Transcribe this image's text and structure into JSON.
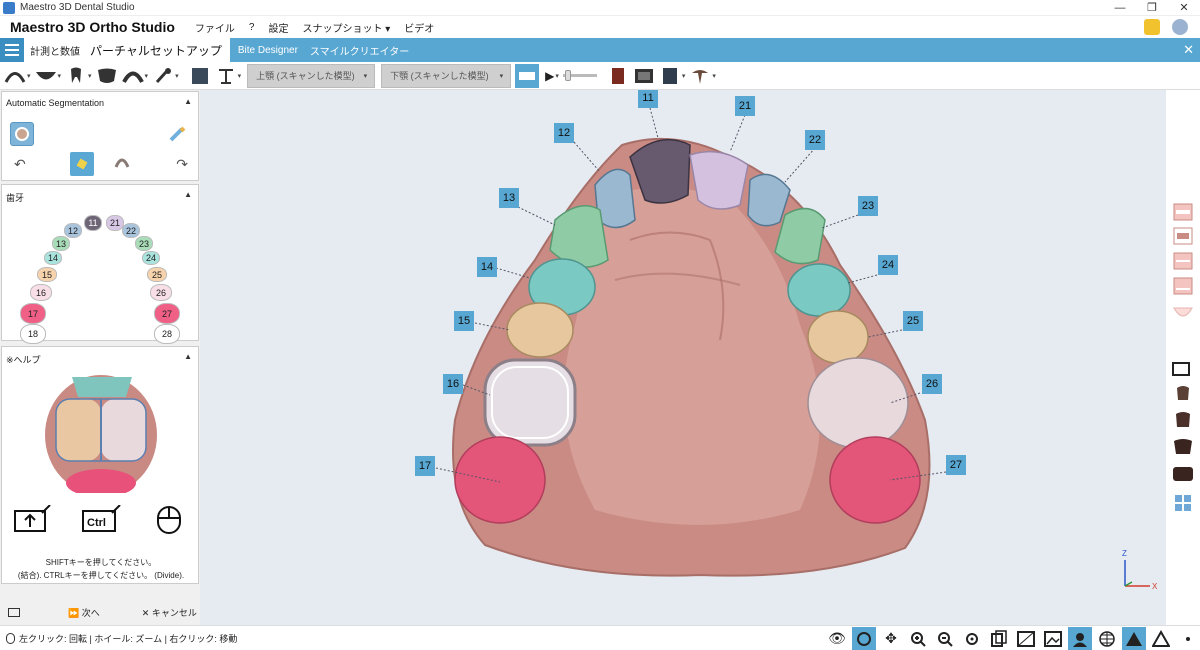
{
  "window": {
    "title": "Maestro 3D Dental Studio",
    "minimize": "—",
    "maximize": "❐",
    "close": "✕"
  },
  "menu": {
    "brand": "Maestro 3D Ortho Studio",
    "items": [
      "ファイル",
      "?",
      "設定",
      "スナップショット",
      "ビデオ"
    ],
    "snapshot_caret": "▾"
  },
  "modebar": {
    "tab_measure": "計測と数値",
    "tab_partial": "パーチャルセットアップ",
    "tab_bite": "Bite Designer",
    "tab_smile": "スマイルクリエイター",
    "close": "✕"
  },
  "toolbar": {
    "upper_select": "上顎 (スキャンした模型)",
    "lower_select": "下顎 (スキャンした模型)",
    "play": "▶",
    "caret": "▾"
  },
  "segmentation": {
    "title": "Automatic Segmentation",
    "collapse": "▲",
    "undo": "↶",
    "redo": "↷"
  },
  "teeth_panel": {
    "title": "歯牙",
    "collapse": "▲",
    "chips": [
      {
        "n": "11",
        "c": "#6e6577"
      },
      {
        "n": "21",
        "c": "#d9c7e6"
      },
      {
        "n": "12",
        "c": "#a9c4dd"
      },
      {
        "n": "22",
        "c": "#a9c4dd"
      },
      {
        "n": "13",
        "c": "#a9dcb8"
      },
      {
        "n": "23",
        "c": "#a9dcb8"
      },
      {
        "n": "14",
        "c": "#a8e3dd"
      },
      {
        "n": "24",
        "c": "#a8e3dd"
      },
      {
        "n": "15",
        "c": "#f6d3ac"
      },
      {
        "n": "25",
        "c": "#f6d3ac"
      },
      {
        "n": "16",
        "c": "#f8dee6"
      },
      {
        "n": "26",
        "c": "#f8dee6"
      },
      {
        "n": "17",
        "c": "#ef5f86"
      },
      {
        "n": "27",
        "c": "#ef5f86"
      },
      {
        "n": "18",
        "c": "#ffffff"
      },
      {
        "n": "28",
        "c": "#ffffff"
      }
    ]
  },
  "help_panel": {
    "title": "※ヘルプ",
    "collapse": "▲",
    "ctrl_key": "Ctrl",
    "line1": "SHIFTキーを押してください。",
    "line2": "(結合). CTRLキーを押してください。 (Divide)."
  },
  "footer_left": {
    "next": "次へ",
    "next_icon": "⏩",
    "cancel": "キャンセル",
    "cancel_icon": "✕"
  },
  "viewport": {
    "labels": [
      "11",
      "21",
      "12",
      "22",
      "13",
      "23",
      "14",
      "24",
      "15",
      "25",
      "16",
      "26",
      "17",
      "27"
    ],
    "axis_z": "Z",
    "axis_x": "X",
    "colors": {
      "gum": "#c98b84",
      "bg": "#e6ebf2",
      "label": "#58a7d2"
    }
  },
  "status": {
    "text": "左クリック: 回転 | ホイール: ズーム | 右クリック: 移動"
  }
}
